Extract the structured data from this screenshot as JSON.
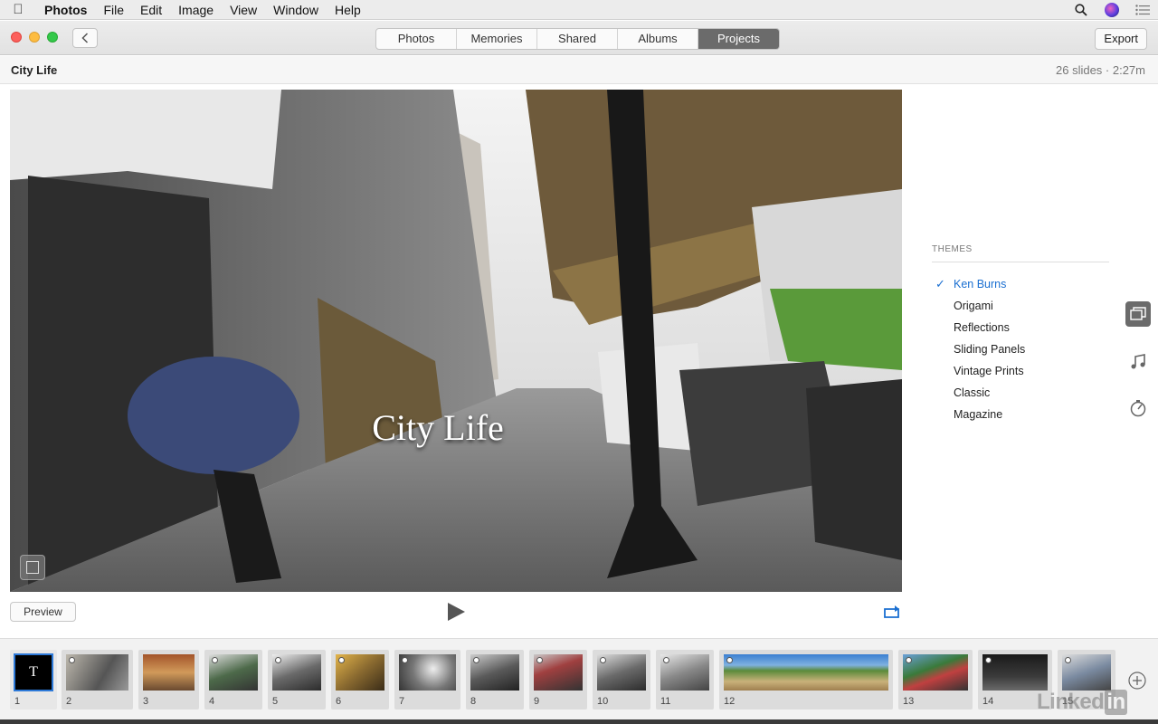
{
  "menubar": {
    "app": "Photos",
    "items": [
      "File",
      "Edit",
      "Image",
      "View",
      "Window",
      "Help"
    ]
  },
  "toolbar": {
    "tabs": [
      {
        "label": "Photos",
        "active": false
      },
      {
        "label": "Memories",
        "active": false
      },
      {
        "label": "Shared",
        "active": false
      },
      {
        "label": "Albums",
        "active": false
      },
      {
        "label": "Projects",
        "active": true
      }
    ],
    "export_label": "Export"
  },
  "project": {
    "title": "City Life",
    "meta": "26 slides · 2:27m"
  },
  "viewer": {
    "title_overlay": "City Life"
  },
  "controls": {
    "preview_label": "Preview"
  },
  "themes": {
    "header": "THEMES",
    "items": [
      {
        "label": "Ken Burns",
        "selected": true
      },
      {
        "label": "Origami",
        "selected": false
      },
      {
        "label": "Reflections",
        "selected": false
      },
      {
        "label": "Sliding Panels",
        "selected": false
      },
      {
        "label": "Vintage Prints",
        "selected": false
      },
      {
        "label": "Classic",
        "selected": false
      },
      {
        "label": "Magazine",
        "selected": false
      }
    ]
  },
  "filmstrip": {
    "slides": [
      {
        "number": "1"
      },
      {
        "number": "2"
      },
      {
        "number": "3"
      },
      {
        "number": "4"
      },
      {
        "number": "5"
      },
      {
        "number": "6"
      },
      {
        "number": "7"
      },
      {
        "number": "8"
      },
      {
        "number": "9"
      },
      {
        "number": "10"
      },
      {
        "number": "11"
      },
      {
        "number": "12"
      },
      {
        "number": "13"
      },
      {
        "number": "14"
      },
      {
        "number": "15"
      }
    ],
    "title_card_letter": "T"
  },
  "watermark": {
    "text": "Linked",
    "suffix": "in"
  },
  "colors": {
    "accent": "#1a6fd1",
    "active_tab": "#6b6b6b",
    "close": "#fc605c",
    "minimize": "#fdbc40",
    "zoom": "#34c84a"
  }
}
